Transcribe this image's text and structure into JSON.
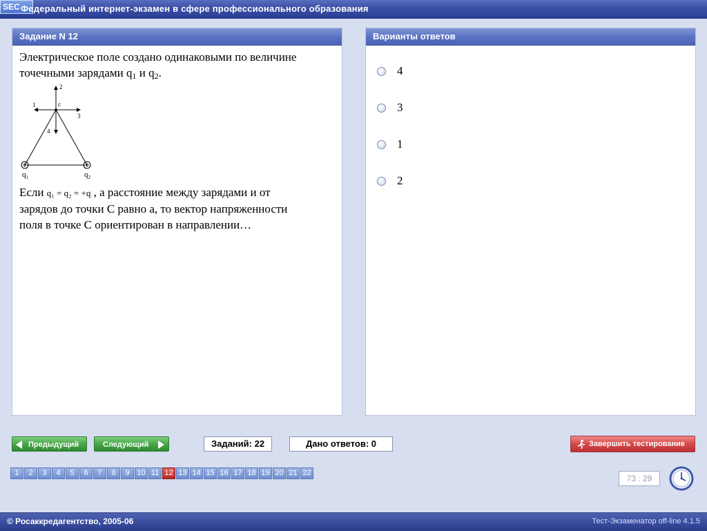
{
  "app": {
    "logo_text": "SEC",
    "title": "Федеральный интернет-экзамен в сфере профессионального образования"
  },
  "task": {
    "header": "Задание N 12",
    "text_line1": "Электрическое поле создано одинаковыми по величине",
    "text_line2_prefix": "точечными зарядами q",
    "q1_sub": "1",
    "text_line2_mid": " и q",
    "q2_sub": "2",
    "text_line2_suffix": ".",
    "figure": {
      "label_c": "c",
      "label_1": "1",
      "label_2": "2",
      "label_3": "3",
      "label_4": "4",
      "charge1": "q",
      "charge1_sub": "1",
      "charge2": "q",
      "charge2_sub": "2"
    },
    "text_line3_prefix": "Если ",
    "formula": "q₁ = q₂ = +q",
    "text_line3_suffix": " , а расстояние между зарядами и от",
    "text_line4": "зарядов до точки С равно а, то вектор напряженности",
    "text_line5": "поля в точке С ориентирован  в направлении…"
  },
  "answers": {
    "header": "Варианты ответов",
    "options": [
      {
        "label": "4"
      },
      {
        "label": "3"
      },
      {
        "label": "1"
      },
      {
        "label": "2"
      }
    ]
  },
  "nav": {
    "prev_label": "Предыдущий",
    "next_label": "Следующий",
    "tasks_count": "Заданий: 22",
    "answered_count": "Дано ответов: 0",
    "finish_label": "Завершить тестирование",
    "pages": [
      "1",
      "2",
      "3",
      "4",
      "5",
      "6",
      "7",
      "8",
      "9",
      "10",
      "11",
      "12",
      "13",
      "14",
      "15",
      "16",
      "17",
      "18",
      "19",
      "20",
      "21",
      "22"
    ],
    "current_page": "12",
    "timer": "73 : 29"
  },
  "footer": {
    "copyright": "© Росаккредагентство, 2005-06",
    "version": "Тест-Экзаменатор off-line 4.1.5"
  }
}
